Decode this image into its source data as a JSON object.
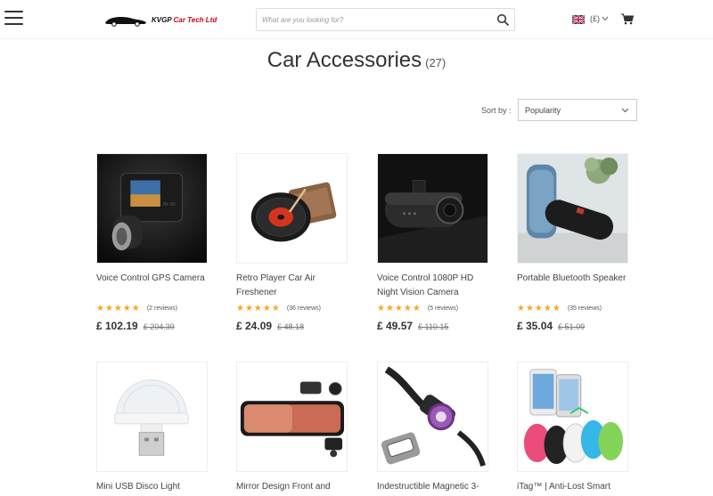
{
  "header": {
    "store_name_part1": "KVGP",
    "store_name_part2": "Car Tech Ltd",
    "search_placeholder": "What are you looking for?",
    "currency": "(£)",
    "flag_icon": "uk-flag-icon",
    "cart_icon": "cart-icon",
    "search_icon": "search-icon",
    "menu_icon": "hamburger-menu-icon"
  },
  "page": {
    "title": "Car Accessories",
    "count": "(27)"
  },
  "sort": {
    "label": "Sort by :",
    "selected": "Popularity"
  },
  "colors": {
    "star": "#f5a623",
    "logo_red": "#d0021b"
  },
  "products": [
    {
      "name": "Voice Control GPS Camera",
      "stars": "★★★★★",
      "reviews": "(2 reviews)",
      "price": "£ 102.19",
      "old_price": "£ 204.39"
    },
    {
      "name": "Retro Player Car Air Freshener",
      "stars": "★★★★★",
      "reviews": "(36 reviews)",
      "price": "£ 24.09",
      "old_price": "£ 48.18"
    },
    {
      "name": "Voice Control 1080P HD Night Vision Camera",
      "stars": "★★★★★",
      "reviews": "(5 reviews)",
      "price": "£ 49.57",
      "old_price": "£ 110.15"
    },
    {
      "name": "Portable Bluetooth Speaker",
      "stars": "★★★★★",
      "reviews": "(35 reviews)",
      "price": "£ 35.04",
      "old_price": "£ 51.09"
    },
    {
      "name": "Mini USB Disco Light",
      "stars": "",
      "reviews": "",
      "price": "",
      "old_price": ""
    },
    {
      "name": "Mirror Design Front and",
      "stars": "",
      "reviews": "",
      "price": "",
      "old_price": ""
    },
    {
      "name": "Indestructible Magnetic 3-",
      "stars": "",
      "reviews": "",
      "price": "",
      "old_price": ""
    },
    {
      "name": "iTag™ | Anti-Lost Smart",
      "stars": "",
      "reviews": "",
      "price": "",
      "old_price": ""
    }
  ]
}
